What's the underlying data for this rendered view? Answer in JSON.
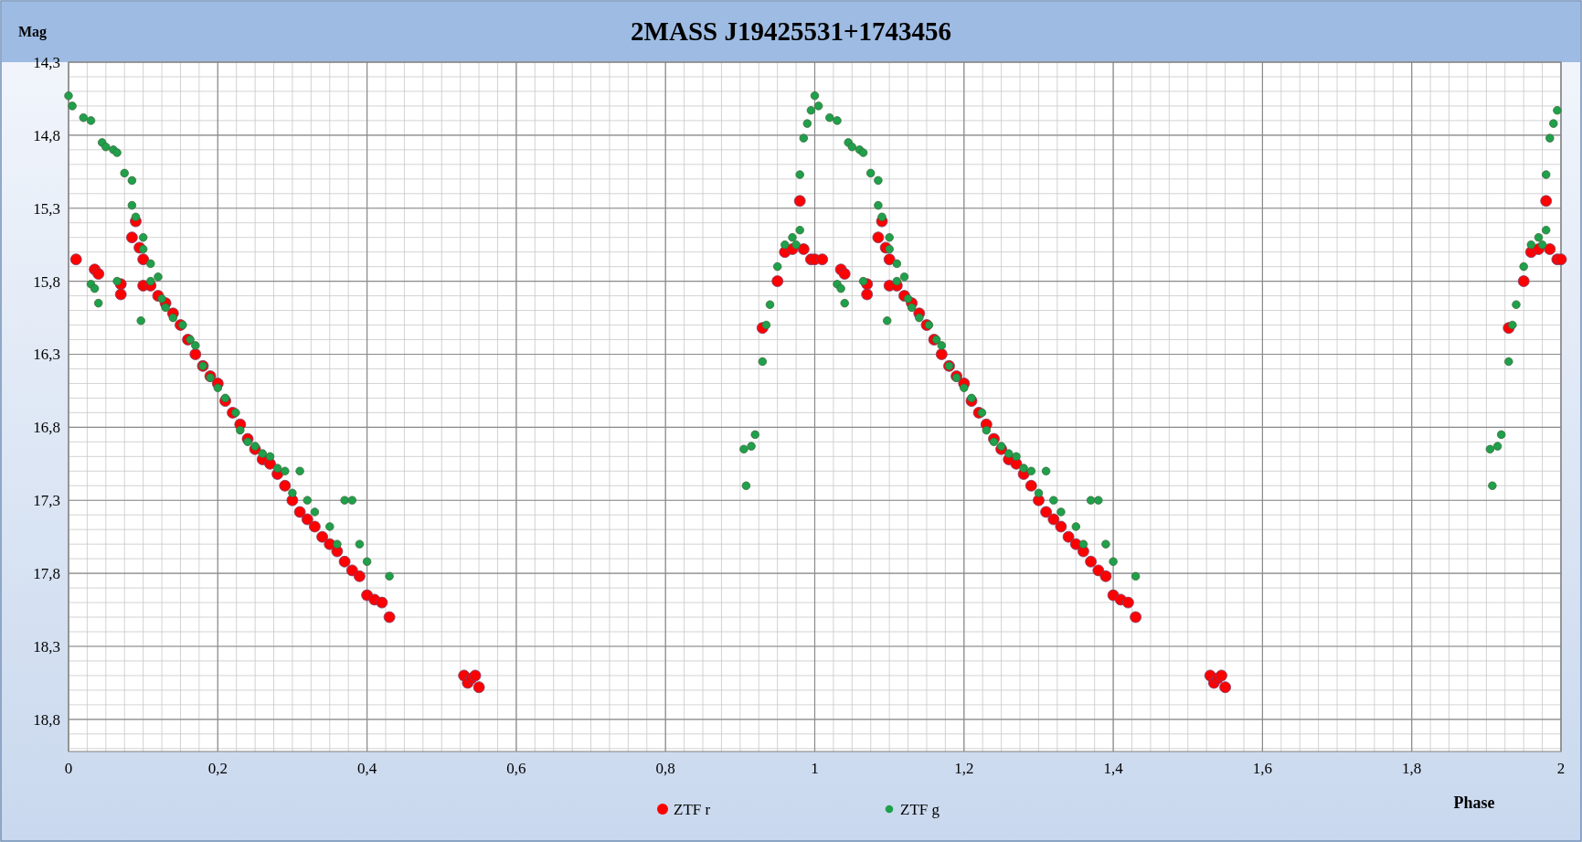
{
  "chart_data": {
    "type": "scatter",
    "title": "2MASS J19425531+1743456",
    "xlabel": "Phase",
    "ylabel": "Mag",
    "xlim": [
      0,
      2
    ],
    "ylim": [
      19.02,
      14.3
    ],
    "grid": true,
    "legend": "bottom",
    "xticks": [
      {
        "value": 0,
        "label": "0"
      },
      {
        "value": 0.2,
        "label": "0,2"
      },
      {
        "value": 0.4,
        "label": "0,4"
      },
      {
        "value": 0.6,
        "label": "0,6"
      },
      {
        "value": 0.8,
        "label": "0,8"
      },
      {
        "value": 1,
        "label": "1"
      },
      {
        "value": 1.2,
        "label": "1,2"
      },
      {
        "value": 1.4,
        "label": "1,4"
      },
      {
        "value": 1.6,
        "label": "1,6"
      },
      {
        "value": 1.8,
        "label": "1,8"
      },
      {
        "value": 2,
        "label": "2"
      }
    ],
    "yticks": [
      {
        "value": 14.3,
        "label": "14,3"
      },
      {
        "value": 14.8,
        "label": "14,8"
      },
      {
        "value": 15.3,
        "label": "15,3"
      },
      {
        "value": 15.8,
        "label": "15,8"
      },
      {
        "value": 16.3,
        "label": "16,3"
      },
      {
        "value": 16.8,
        "label": "16,8"
      },
      {
        "value": 17.3,
        "label": "17,3"
      },
      {
        "value": 17.8,
        "label": "17,8"
      },
      {
        "value": 18.3,
        "label": "18,3"
      },
      {
        "value": 18.8,
        "label": "18,8"
      }
    ],
    "series": [
      {
        "name": "ZTF r",
        "color": "#ff0000",
        "x": [
          0.01,
          0.035,
          0.04,
          0.07,
          0.07,
          0.085,
          0.09,
          0.095,
          0.1,
          0.1,
          0.11,
          0.12,
          0.13,
          0.14,
          0.15,
          0.16,
          0.17,
          0.18,
          0.19,
          0.2,
          0.21,
          0.22,
          0.23,
          0.24,
          0.25,
          0.26,
          0.27,
          0.28,
          0.29,
          0.3,
          0.31,
          0.32,
          0.33,
          0.34,
          0.35,
          0.36,
          0.37,
          0.38,
          0.39,
          0.4,
          0.41,
          0.42,
          0.43,
          0.53,
          0.535,
          0.54,
          0.545,
          0.55,
          0.93,
          0.95,
          0.96,
          0.97,
          0.98,
          0.985,
          0.995,
          1.0,
          1.01,
          1.035,
          1.04,
          1.07,
          1.07,
          1.085,
          1.09,
          1.095,
          1.1,
          1.1,
          1.11,
          1.12,
          1.13,
          1.14,
          1.15,
          1.16,
          1.17,
          1.18,
          1.19,
          1.2,
          1.21,
          1.22,
          1.23,
          1.24,
          1.25,
          1.26,
          1.27,
          1.28,
          1.29,
          1.3,
          1.31,
          1.32,
          1.33,
          1.34,
          1.35,
          1.36,
          1.37,
          1.38,
          1.39,
          1.4,
          1.41,
          1.42,
          1.43,
          1.53,
          1.535,
          1.54,
          1.545,
          1.55,
          1.93,
          1.95,
          1.96,
          1.97,
          1.98,
          1.985,
          1.995,
          2.0
        ],
        "values": [
          15.65,
          15.72,
          15.75,
          15.82,
          15.89,
          15.5,
          15.39,
          15.57,
          15.65,
          15.83,
          15.83,
          15.9,
          15.95,
          16.02,
          16.1,
          16.2,
          16.3,
          16.38,
          16.45,
          16.5,
          16.62,
          16.7,
          16.78,
          16.88,
          16.95,
          17.02,
          17.05,
          17.12,
          17.2,
          17.3,
          17.38,
          17.43,
          17.48,
          17.55,
          17.6,
          17.65,
          17.72,
          17.78,
          17.82,
          17.95,
          17.98,
          18.0,
          18.1,
          18.5,
          18.55,
          18.52,
          18.5,
          18.58,
          16.12,
          15.8,
          15.6,
          15.58,
          15.25,
          15.58,
          15.65,
          15.65,
          15.65,
          15.72,
          15.75,
          15.82,
          15.89,
          15.5,
          15.39,
          15.57,
          15.65,
          15.83,
          15.83,
          15.9,
          15.95,
          16.02,
          16.1,
          16.2,
          16.3,
          16.38,
          16.45,
          16.5,
          16.62,
          16.7,
          16.78,
          16.88,
          16.95,
          17.02,
          17.05,
          17.12,
          17.2,
          17.3,
          17.38,
          17.43,
          17.48,
          17.55,
          17.6,
          17.65,
          17.72,
          17.78,
          17.82,
          17.95,
          17.98,
          18.0,
          18.1,
          18.5,
          18.55,
          18.52,
          18.5,
          18.58,
          16.12,
          15.8,
          15.6,
          15.58,
          15.25,
          15.58,
          15.65,
          15.65
        ]
      },
      {
        "name": "ZTF g",
        "color": "#1fa04a",
        "x": [
          0,
          0.005,
          0.02,
          0.03,
          0.045,
          0.05,
          0.06,
          0.065,
          0.075,
          0.085,
          0.085,
          0.09,
          0.1,
          0.1,
          0.11,
          0.11,
          0.12,
          0.125,
          0.13,
          0.14,
          0.153,
          0.163,
          0.17,
          0.18,
          0.19,
          0.2,
          0.21,
          0.224,
          0.23,
          0.24,
          0.25,
          0.26,
          0.27,
          0.28,
          0.29,
          0.3,
          0.31,
          0.32,
          0.33,
          0.35,
          0.36,
          0.37,
          0.38,
          0.39,
          0.4,
          0.43,
          0.03,
          0.035,
          0.04,
          0.065,
          0.097,
          0.905,
          0.908,
          0.915,
          0.92,
          0.93,
          0.935,
          0.94,
          0.95,
          0.96,
          0.97,
          0.975,
          0.98,
          0.98,
          0.985,
          0.99,
          0.995,
          1,
          1.005,
          1.02,
          1.03,
          1.045,
          1.05,
          1.06,
          1.065,
          1.075,
          1.085,
          1.085,
          1.09,
          1.1,
          1.1,
          1.11,
          1.11,
          1.12,
          1.125,
          1.13,
          1.14,
          1.153,
          1.163,
          1.17,
          1.18,
          1.19,
          1.2,
          1.21,
          1.224,
          1.23,
          1.24,
          1.25,
          1.26,
          1.27,
          1.28,
          1.29,
          1.3,
          1.31,
          1.32,
          1.33,
          1.35,
          1.36,
          1.37,
          1.38,
          1.39,
          1.4,
          1.43,
          1.03,
          1.035,
          1.04,
          1.065,
          1.097,
          1.905,
          1.908,
          1.915,
          1.92,
          1.93,
          1.935,
          1.94,
          1.95,
          1.96,
          1.97,
          1.975,
          1.98,
          1.98,
          1.985,
          1.99,
          1.995
        ],
        "values": [
          14.53,
          14.6,
          14.68,
          14.7,
          14.85,
          14.88,
          14.9,
          14.92,
          15.06,
          15.11,
          15.28,
          15.36,
          15.5,
          15.58,
          15.68,
          15.8,
          15.77,
          15.92,
          15.98,
          16.05,
          16.1,
          16.2,
          16.24,
          16.38,
          16.46,
          16.53,
          16.6,
          16.7,
          16.82,
          16.9,
          16.93,
          16.98,
          17.0,
          17.08,
          17.1,
          17.25,
          17.1,
          17.3,
          17.38,
          17.48,
          17.6,
          17.3,
          17.3,
          17.6,
          17.72,
          17.82,
          15.82,
          15.85,
          15.95,
          15.8,
          16.07,
          16.95,
          17.2,
          16.93,
          16.85,
          16.35,
          16.1,
          15.96,
          15.7,
          15.55,
          15.5,
          15.55,
          15.45,
          15.07,
          14.82,
          14.72,
          14.63,
          14.53,
          14.6,
          14.68,
          14.7,
          14.85,
          14.88,
          14.9,
          14.92,
          15.06,
          15.11,
          15.28,
          15.36,
          15.5,
          15.58,
          15.68,
          15.8,
          15.77,
          15.92,
          15.98,
          16.05,
          16.1,
          16.2,
          16.24,
          16.38,
          16.46,
          16.53,
          16.6,
          16.7,
          16.82,
          16.9,
          16.93,
          16.98,
          17.0,
          17.08,
          17.1,
          17.25,
          17.1,
          17.3,
          17.38,
          17.48,
          17.6,
          17.3,
          17.3,
          17.6,
          17.72,
          17.82,
          15.82,
          15.85,
          15.95,
          15.8,
          16.07,
          16.95,
          17.2,
          16.93,
          16.85,
          16.35,
          16.1,
          15.96,
          15.7,
          15.55,
          15.5,
          15.55,
          15.45,
          15.07,
          14.82,
          14.72,
          14.63
        ]
      }
    ]
  }
}
